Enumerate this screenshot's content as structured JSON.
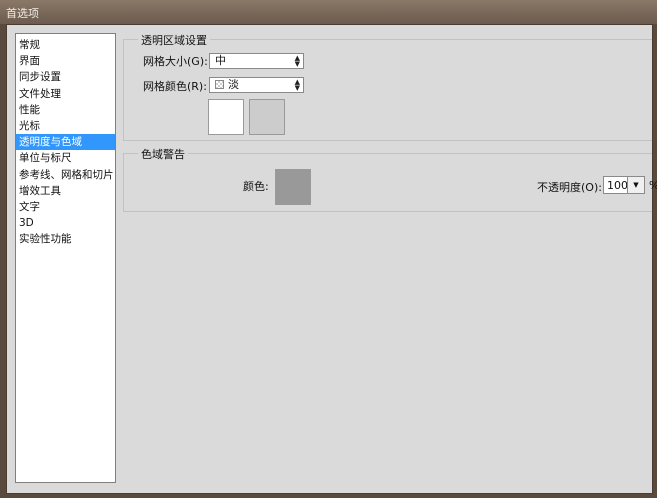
{
  "window": {
    "title": "首选项"
  },
  "sidebar": {
    "items": [
      {
        "label": "常规"
      },
      {
        "label": "界面"
      },
      {
        "label": "同步设置"
      },
      {
        "label": "文件处理"
      },
      {
        "label": "性能"
      },
      {
        "label": "光标"
      },
      {
        "label": "透明度与色域",
        "selected": true
      },
      {
        "label": "单位与标尺"
      },
      {
        "label": "参考线、网格和切片"
      },
      {
        "label": "增效工具"
      },
      {
        "label": "文字"
      },
      {
        "label": "3D"
      },
      {
        "label": "实验性功能"
      }
    ]
  },
  "transparency": {
    "title": "透明区域设置",
    "grid_size_label": "网格大小(G):",
    "grid_size_value": "中",
    "grid_color_label": "网格颜色(R):",
    "grid_color_value": "淡",
    "swatch1_color": "#ffffff",
    "swatch2_color": "#cccccc"
  },
  "gamut": {
    "title": "色域警告",
    "color_label": "颜色:",
    "color_value": "#999999",
    "opacity_label": "不透明度(O):",
    "opacity_value": "100",
    "opacity_unit": "%"
  },
  "icons": {
    "select_arrows": "up-down-arrows-icon",
    "dropdown": "caret-down-icon",
    "checker": "checkerboard-icon"
  }
}
